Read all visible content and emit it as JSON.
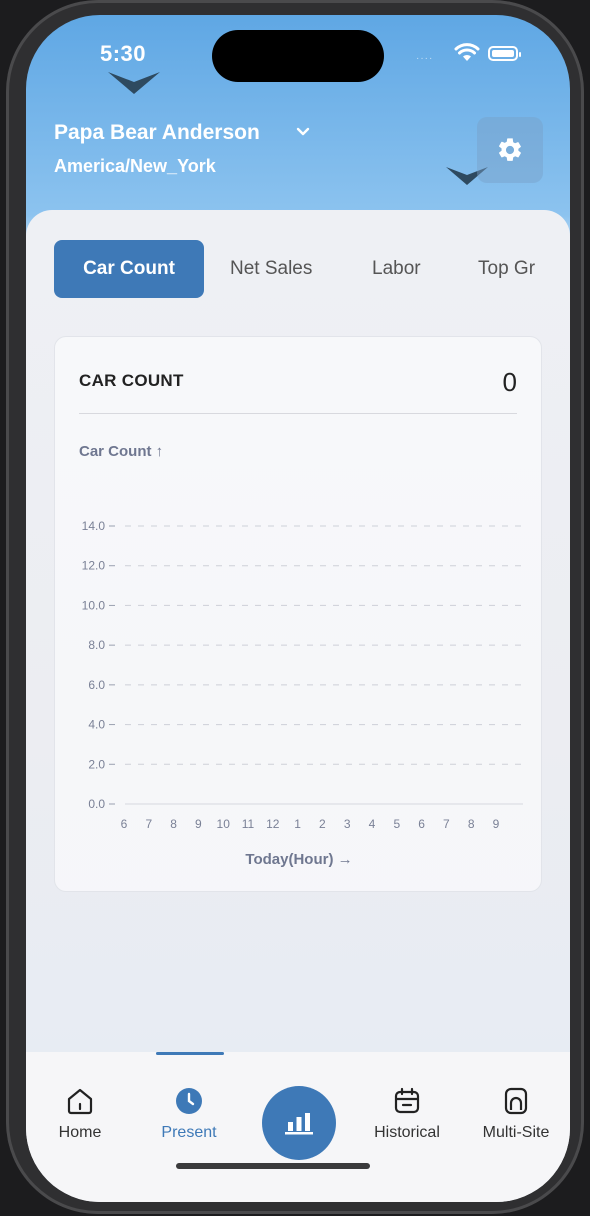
{
  "status_bar": {
    "time": "5:30",
    "signal_dots": "····"
  },
  "header": {
    "user_name": "Papa Bear Anderson",
    "timezone": "America/New_York"
  },
  "tabs": [
    {
      "label": "Car Count",
      "active": true
    },
    {
      "label": "Net Sales",
      "active": false
    },
    {
      "label": "Labor",
      "active": false
    },
    {
      "label": "Top Gr",
      "active": false
    }
  ],
  "card": {
    "title": "CAR COUNT",
    "value": "0",
    "y_axis_label": "Car Count ↑",
    "x_axis_label": "Today(Hour) →"
  },
  "chart_data": {
    "type": "line",
    "title": "CAR COUNT",
    "xlabel": "Today(Hour)",
    "ylabel": "Car Count",
    "y_ticks": [
      "0.0",
      "2.0",
      "4.0",
      "6.0",
      "8.0",
      "10.0",
      "12.0",
      "14.0"
    ],
    "x_ticks": [
      "6",
      "7",
      "8",
      "9",
      "10",
      "11",
      "12",
      "1",
      "2",
      "3",
      "4",
      "5",
      "6",
      "7",
      "8",
      "9"
    ],
    "ylim": [
      0,
      14
    ],
    "series": [],
    "grid": true
  },
  "bottom_nav": [
    {
      "label": "Home",
      "icon": "home-icon"
    },
    {
      "label": "Present",
      "icon": "clock-icon",
      "active": true
    },
    {
      "label": "",
      "icon": "bar-chart-icon"
    },
    {
      "label": "Historical",
      "icon": "calendar-icon"
    },
    {
      "label": "Multi-Site",
      "icon": "site-icon"
    }
  ],
  "colors": {
    "accent": "#3e79b7",
    "header_top": "#5fa7e4",
    "header_bottom": "#8cc3ef",
    "axis_text": "#6f7790"
  }
}
